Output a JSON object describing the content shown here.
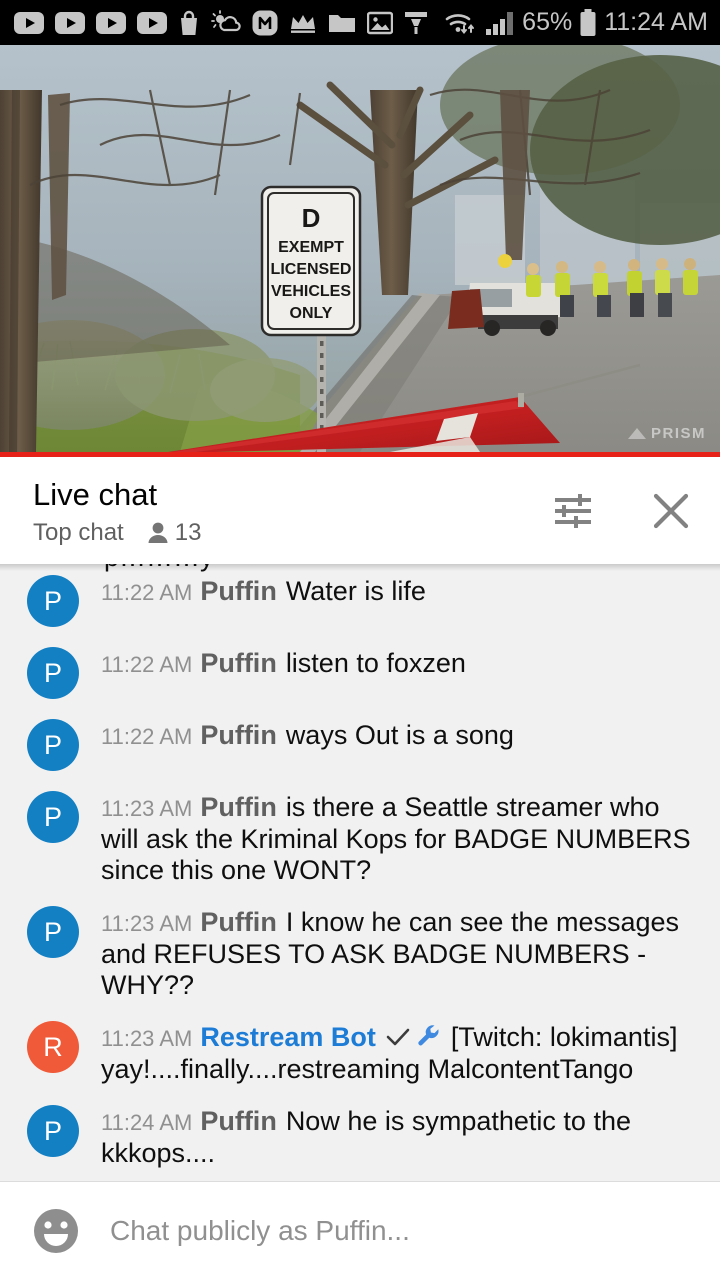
{
  "status_bar": {
    "icons": [
      "youtube-icon",
      "youtube-icon",
      "youtube-icon",
      "youtube-icon",
      "shopping-bag-icon",
      "weather-partly-cloudy-icon",
      "m-circle-icon",
      "crown-icon",
      "folder-icon",
      "photo-icon",
      "funnel-icon"
    ],
    "wifi_icon": "wifi-transfer-icon",
    "signal_icon": "cell-signal-icon",
    "battery_percent": "65%",
    "battery_icon": "battery-icon",
    "time": "11:24 AM"
  },
  "video": {
    "sign_lines": [
      "D",
      "EXEMPT",
      "LICENSED",
      "VEHICLES",
      "ONLY"
    ],
    "watermark": "PRISM",
    "progress_percent": 100
  },
  "chat_header": {
    "title": "Live chat",
    "subtitle": "Top chat",
    "viewer_icon": "person-icon",
    "viewer_count": "13",
    "settings_icon": "tune-settings-icon",
    "close_icon": "close-icon"
  },
  "clipped_message": {
    "text": "p………y"
  },
  "messages": [
    {
      "avatar_letter": "P",
      "avatar_color": "#1380c4",
      "timestamp": "11:22 AM",
      "author": "Puffin",
      "author_is_bot": false,
      "badges": [],
      "text": "Water is life"
    },
    {
      "avatar_letter": "P",
      "avatar_color": "#1380c4",
      "timestamp": "11:22 AM",
      "author": "Puffin",
      "author_is_bot": false,
      "badges": [],
      "text": "listen to foxzen"
    },
    {
      "avatar_letter": "P",
      "avatar_color": "#1380c4",
      "timestamp": "11:22 AM",
      "author": "Puffin",
      "author_is_bot": false,
      "badges": [],
      "text": "ways Out is a song"
    },
    {
      "avatar_letter": "P",
      "avatar_color": "#1380c4",
      "timestamp": "11:23 AM",
      "author": "Puffin",
      "author_is_bot": false,
      "badges": [],
      "text": "is there a Seattle streamer who will ask the Kriminal Kops for BADGE NUMBERS since this one WONT?"
    },
    {
      "avatar_letter": "P",
      "avatar_color": "#1380c4",
      "timestamp": "11:23 AM",
      "author": "Puffin",
      "author_is_bot": false,
      "badges": [],
      "text": "I know he can see the messages and REFUSES TO ASK BADGE NUMBERS - WHY??"
    },
    {
      "avatar_letter": "R",
      "avatar_color": "#f05a38",
      "timestamp": "11:23 AM",
      "author": "Restream Bot",
      "author_is_bot": true,
      "badges": [
        "verified-check-icon",
        "moderator-wrench-icon"
      ],
      "text": "[Twitch: lokimantis] yay!....finally....restreaming MalcontentTango"
    },
    {
      "avatar_letter": "P",
      "avatar_color": "#1380c4",
      "timestamp": "11:24 AM",
      "author": "Puffin",
      "author_is_bot": false,
      "badges": [],
      "text": "Now he is sympathetic to the kkkops...."
    }
  ],
  "input_bar": {
    "emoji_icon": "emoji-smiley-icon",
    "placeholder": "Chat publicly as Puffin...",
    "value": ""
  },
  "colors": {
    "accent_red": "#e62117",
    "avatar_blue": "#1380c4",
    "avatar_orange": "#f05a38",
    "bot_name_blue": "#1c7cd6",
    "wrench_blue": "#3f8ae0",
    "chat_bg": "#f1f1f1"
  }
}
